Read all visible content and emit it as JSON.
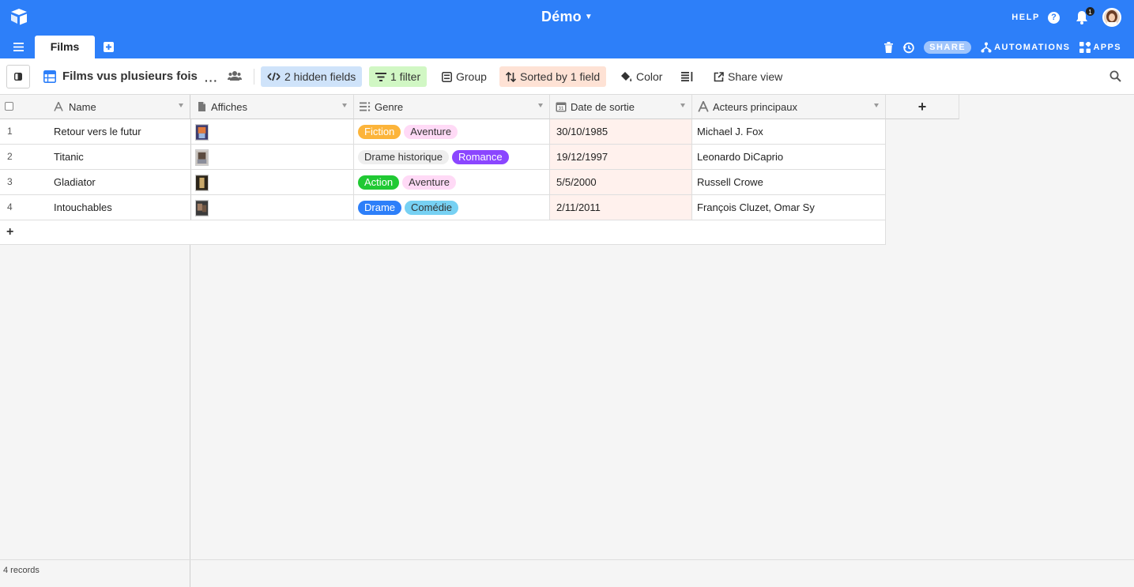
{
  "app": {
    "base_title": "Démo",
    "help_label": "HELP",
    "notifications_count": "1",
    "colors": {
      "topbar": "#2d7ff9"
    }
  },
  "tabs": [
    {
      "label": "Films"
    }
  ],
  "topbar_actions": {
    "share_label": "SHARE",
    "automations_label": "AUTOMATIONS",
    "apps_label": "APPS"
  },
  "view": {
    "name": "Films vus plusieurs fois",
    "hidden_fields_label": "2 hidden fields",
    "filter_label": "1 filter",
    "group_label": "Group",
    "sorted_label": "Sorted by 1 field",
    "color_label": "Color",
    "share_view_label": "Share view"
  },
  "table": {
    "columns": [
      {
        "label": "Name",
        "icon": "text-icon"
      },
      {
        "label": "Affiches",
        "icon": "attachment-icon"
      },
      {
        "label": "Genre",
        "icon": "multiselect-icon"
      },
      {
        "label": "Date de sortie",
        "icon": "calendar-icon"
      },
      {
        "label": "Acteurs principaux",
        "icon": "text-icon"
      }
    ],
    "rows": [
      {
        "num": "1",
        "name": "Retour vers le futur",
        "genres": [
          {
            "label": "Fiction",
            "bg": "#fcb43a",
            "fg": "#ffffff"
          },
          {
            "label": "Aventure",
            "bg": "#ffdaf6",
            "fg": "#333333"
          }
        ],
        "date": "30/10/1985",
        "actors": "Michael J. Fox"
      },
      {
        "num": "2",
        "name": "Titanic",
        "genres": [
          {
            "label": "Drame historique",
            "bg": "#eeeeee",
            "fg": "#333333"
          },
          {
            "label": "Romance",
            "bg": "#8b46ff",
            "fg": "#ffffff"
          }
        ],
        "date": "19/12/1997",
        "actors": "Leonardo DiCaprio"
      },
      {
        "num": "3",
        "name": "Gladiator",
        "genres": [
          {
            "label": "Action",
            "bg": "#20c933",
            "fg": "#ffffff"
          },
          {
            "label": "Aventure",
            "bg": "#ffdaf6",
            "fg": "#333333"
          }
        ],
        "date": "5/5/2000",
        "actors": "Russell Crowe"
      },
      {
        "num": "4",
        "name": "Intouchables",
        "genres": [
          {
            "label": "Drame",
            "bg": "#2d7ff9",
            "fg": "#ffffff"
          },
          {
            "label": "Comédie",
            "bg": "#77d1f3",
            "fg": "#333333"
          }
        ],
        "date": "2/11/2011",
        "actors": "François Cluzet, Omar Sy"
      }
    ],
    "record_count_label": "4 records",
    "add_row_label": "+",
    "add_column_label": "+"
  }
}
